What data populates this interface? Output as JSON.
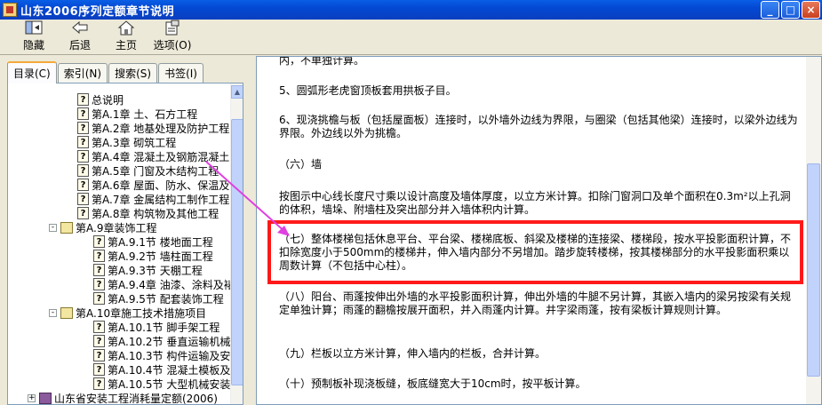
{
  "window": {
    "title": "山东2006序列定额章节说明"
  },
  "toolbar": {
    "hide": "隐藏",
    "back": "后退",
    "home": "主页",
    "options": "选项(O)"
  },
  "tabs": [
    "目录(C)",
    "索引(N)",
    "搜索(S)",
    "书签(I)"
  ],
  "tree": [
    {
      "text": "总说明",
      "level": 2,
      "icon": "page"
    },
    {
      "text": "第A.1章 土、石方工程",
      "level": 2,
      "icon": "page"
    },
    {
      "text": "第A.2章 地基处理及防护工程",
      "level": 2,
      "icon": "page"
    },
    {
      "text": "第A.3章 砌筑工程",
      "level": 2,
      "icon": "page"
    },
    {
      "text": "第A.4章 混凝土及钢筋混凝土",
      "level": 2,
      "icon": "page"
    },
    {
      "text": "第A.5章 门窗及木结构工程",
      "level": 2,
      "icon": "page"
    },
    {
      "text": "第A.6章 屋面、防水、保温及",
      "level": 2,
      "icon": "page"
    },
    {
      "text": "第A.7章 金属结构工制作工程",
      "level": 2,
      "icon": "page"
    },
    {
      "text": "第A.8章 构筑物及其他工程",
      "level": 2,
      "icon": "page"
    },
    {
      "text": "第A.9章装饰工程",
      "level": 1,
      "icon": "book-open",
      "toggle": "-"
    },
    {
      "text": "第A.9.1节 楼地面工程",
      "level": 3,
      "icon": "page"
    },
    {
      "text": "第A.9.2节 墙柱面工程",
      "level": 3,
      "icon": "page"
    },
    {
      "text": "第A.9.3节 天棚工程",
      "level": 3,
      "icon": "page"
    },
    {
      "text": "第A.9.4章 油漆、涂料及裱",
      "level": 3,
      "icon": "page"
    },
    {
      "text": "第A.9.5节 配套装饰工程",
      "level": 3,
      "icon": "page"
    },
    {
      "text": "第A.10章施工技术措施项目",
      "level": 1,
      "icon": "book-open",
      "toggle": "-"
    },
    {
      "text": "第A.10.1节 脚手架工程",
      "level": 3,
      "icon": "page"
    },
    {
      "text": "第A.10.2节 垂直运输机械",
      "level": 3,
      "icon": "page"
    },
    {
      "text": "第A.10.3节 构件运输及安",
      "level": 3,
      "icon": "page"
    },
    {
      "text": "第A.10.4节 混凝土模板及",
      "level": 3,
      "icon": "page"
    },
    {
      "text": "第A.10.5节 大型机械安装",
      "level": 3,
      "icon": "page"
    },
    {
      "text": "山东省安装工程消耗量定额(2006)",
      "level": 0,
      "icon": "book",
      "toggle": "+"
    }
  ],
  "content": {
    "p0": "内，不单独计算。",
    "p1": "5、圆弧形老虎窗顶板套用拱板子目。",
    "p2": "6、现浇挑檐与板（包括屋面板）连接时，以外墙外边线为界限，与圈梁（包括其他梁）连接时，以梁外边线为界限。外边线以外为挑檐。",
    "p3": "（六）墙",
    "p4": "按图示中心线长度尺寸乘以设计高度及墙体厚度，以立方米计算。扣除门窗洞口及单个面积在0.3m²以上孔洞的体积，墙垛、附墙柱及突出部分并入墙体积内计算。",
    "p5": "（七）整体楼梯包括休息平台、平台梁、楼梯底板、斜梁及楼梯的连接梁、楼梯段，按水平投影面积计算，不扣除宽度小于500mm的楼梯井，伸入墙内部分不另增加。踏步旋转楼梯，按其楼梯部分的水平投影面积乘以周数计算（不包括中心柱）。",
    "p6": "（八）阳台、雨蓬按伸出外墙的水平投影面积计算，伸出外墙的牛腿不另计算，其嵌入墙内的梁另按梁有关规定单独计算；雨蓬的翻檐按展开面积，并入雨蓬内计算。井字梁雨蓬，按有梁板计算规则计算。",
    "p7": "（九）栏板以立方米计算，伸入墙内的栏板，合并计算。",
    "p8": "（十）预制板补现浇板缝，板底缝宽大于10cm时，按平板计算。"
  },
  "colors": {
    "titlebar": "#0a5ee6",
    "highlight": "#ff1a1a",
    "arrow": "#e040e0"
  }
}
